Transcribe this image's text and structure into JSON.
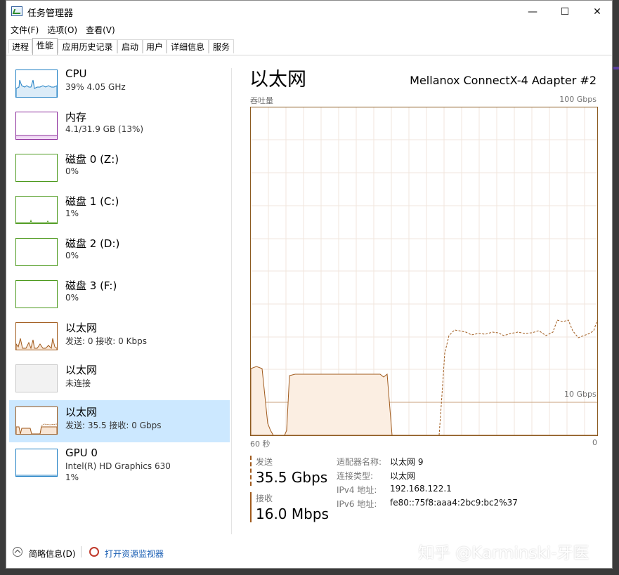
{
  "window": {
    "title": "任务管理器"
  },
  "window_controls": {
    "minimize": "—",
    "maximize": "☐",
    "close": "✕"
  },
  "menu": [
    "文件(F)",
    "选项(O)",
    "查看(V)"
  ],
  "tabs": [
    "进程",
    "性能",
    "应用历史记录",
    "启动",
    "用户",
    "详细信息",
    "服务"
  ],
  "active_tab": "性能",
  "sidebar": {
    "items": [
      {
        "name": "CPU",
        "sub": "39% 4.05 GHz",
        "color": "#1f7fc4"
      },
      {
        "name": "内存",
        "sub": "4.1/31.9 GB (13%)",
        "color": "#8b2a9a"
      },
      {
        "name": "磁盘 0 (Z:)",
        "sub": "0%",
        "color": "#4d9a1e"
      },
      {
        "name": "磁盘 1 (C:)",
        "sub": "1%",
        "color": "#4d9a1e"
      },
      {
        "name": "磁盘 2 (D:)",
        "sub": "0%",
        "color": "#4d9a1e"
      },
      {
        "name": "磁盘 3 (F:)",
        "sub": "0%",
        "color": "#4d9a1e"
      },
      {
        "name": "以太网",
        "sub": "发送: 0 接收: 0 Kbps",
        "color": "#a05a1c"
      },
      {
        "name": "以太网",
        "sub": "未连接",
        "color": "#c8c8c8"
      },
      {
        "name": "以太网",
        "sub": "发送: 35.5 接收: 0 Gbps",
        "color": "#a05a1c",
        "selected": true
      },
      {
        "name": "GPU 0",
        "sub": "Intel(R) HD Graphics 630",
        "sub2": "1%",
        "color": "#1f7fc4"
      }
    ]
  },
  "main": {
    "title": "以太网",
    "adapter": "Mellanox ConnectX-4 Adapter #2",
    "graph": {
      "label_left": "吞吐量",
      "label_right": "100 Gbps",
      "threshold_label": "10 Gbps",
      "x_left": "60 秒",
      "x_right": "0",
      "accent": "#a05a1c"
    },
    "send": {
      "label": "发送",
      "value": "35.5 Gbps"
    },
    "receive": {
      "label": "接收",
      "value": "16.0 Mbps"
    },
    "details": [
      {
        "key": "适配器名称:",
        "value": "以太网 9"
      },
      {
        "key": "连接类型:",
        "value": "以太网"
      },
      {
        "key": "IPv4 地址:",
        "value": "192.168.122.1"
      },
      {
        "key": "IPv6 地址:",
        "value": "fe80::75f8:aaa4:2bc9:bc2%37"
      }
    ]
  },
  "footer": {
    "brief": "简略信息(D)",
    "resource_monitor": "打开资源监视器"
  },
  "watermark": "知乎 @Karminski-牙医"
}
